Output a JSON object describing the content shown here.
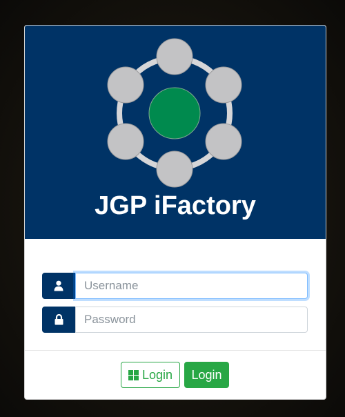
{
  "brand": {
    "title": "JGP iFactory"
  },
  "form": {
    "username": {
      "placeholder": "Username",
      "value": "",
      "icon": "user-icon"
    },
    "password": {
      "placeholder": "Password",
      "value": "",
      "icon": "lock-icon"
    }
  },
  "actions": {
    "microsoft_login_label": "Login",
    "microsoft_login_icon": "windows-icon",
    "login_label": "Login"
  },
  "colors": {
    "header": "#003366",
    "logo_center": "#008A4E",
    "logo_nodes": "#C3C3C5",
    "success": "#28A745",
    "focus": "#80BDFF"
  }
}
